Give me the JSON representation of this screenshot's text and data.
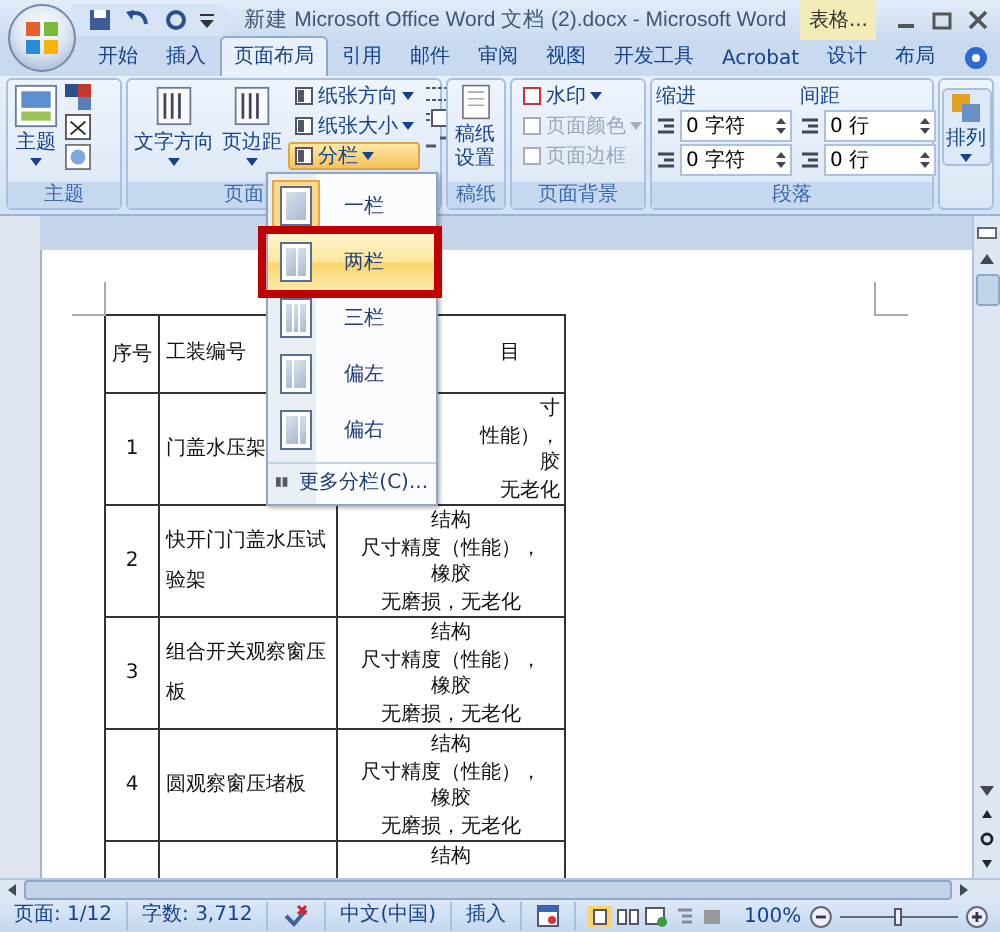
{
  "window": {
    "title": "新建 Microsoft Office Word 文档 (2).docx - Microsoft Word",
    "context_tab": "表格..."
  },
  "tabs": [
    {
      "label": "开始",
      "selected": false
    },
    {
      "label": "插入",
      "selected": false
    },
    {
      "label": "页面布局",
      "selected": true
    },
    {
      "label": "引用",
      "selected": false
    },
    {
      "label": "邮件",
      "selected": false
    },
    {
      "label": "审阅",
      "selected": false
    },
    {
      "label": "视图",
      "selected": false
    },
    {
      "label": "开发工具",
      "selected": false
    },
    {
      "label": "Acrobat",
      "selected": false
    },
    {
      "label": "设计",
      "selected": false
    },
    {
      "label": "布局",
      "selected": false
    }
  ],
  "theme_group": {
    "label": "主题",
    "big_button": "主题"
  },
  "page_setup_group": {
    "label": "页面",
    "big_buttons": [
      "文字方向",
      "页边距"
    ],
    "small_buttons": [
      {
        "label": "纸张方向",
        "active": false
      },
      {
        "label": "纸张大小",
        "active": false
      },
      {
        "label": "分栏",
        "active": true
      }
    ]
  },
  "paper_group": {
    "label": "稿纸",
    "button": "稿纸设置"
  },
  "background_group": {
    "label": "页面背景",
    "buttons": [
      {
        "label": "水印",
        "disabled": false,
        "dropdown": true
      },
      {
        "label": "页面颜色",
        "disabled": true,
        "dropdown": true
      },
      {
        "label": "页面边框",
        "disabled": true,
        "dropdown": false
      }
    ]
  },
  "paragraph_group": {
    "label": "段落",
    "indent": {
      "label": "缩进",
      "fields": [
        "0 字符",
        "0 字符"
      ]
    },
    "spacing": {
      "label": "间距",
      "fields": [
        "0 行",
        "0 行"
      ]
    }
  },
  "arrange_group": {
    "button": "排列"
  },
  "columns_menu": {
    "items": [
      {
        "label": "一栏",
        "kind": "one",
        "current": true,
        "selected": false,
        "marked": false
      },
      {
        "label": "两栏",
        "kind": "two",
        "current": false,
        "selected": true,
        "marked": true
      },
      {
        "label": "三栏",
        "kind": "three",
        "current": false,
        "selected": false,
        "marked": false
      },
      {
        "label": "偏左",
        "kind": "left",
        "current": false,
        "selected": false,
        "marked": false
      },
      {
        "label": "偏右",
        "kind": "right",
        "current": false,
        "selected": false,
        "marked": false
      }
    ],
    "more": "更多分栏(C)..."
  },
  "table": {
    "columns": [
      "序号",
      "工装编号",
      "目"
    ],
    "rows": [
      {
        "no": "1",
        "name": "门盖水压架",
        "covered": true,
        "check": [
          "寸",
          "性能），",
          "胶",
          "无老化"
        ]
      },
      {
        "no": "2",
        "name": "快开门门盖水压试验架",
        "covered": false,
        "check": [
          "结构",
          "尺寸精度（性能），",
          "橡胶",
          "无磨损，无老化"
        ]
      },
      {
        "no": "3",
        "name": "组合开关观察窗压板",
        "covered": false,
        "check": [
          "结构",
          "尺寸精度（性能），",
          "橡胶",
          "无磨损，无老化"
        ]
      },
      {
        "no": "4",
        "name": "圆观察窗压堵板",
        "covered": false,
        "check": [
          "结构",
          "尺寸精度（性能），",
          "橡胶",
          "无磨损，无老化"
        ]
      },
      {
        "covered": false,
        "check": [
          "结构"
        ]
      }
    ]
  },
  "status_bar": {
    "page": "页面: 1/12",
    "words": "字数: 3,712",
    "language": "中文(中国)",
    "mode": "插入",
    "zoom": "100%",
    "zoom_slider": {
      "level": 0.5
    }
  }
}
